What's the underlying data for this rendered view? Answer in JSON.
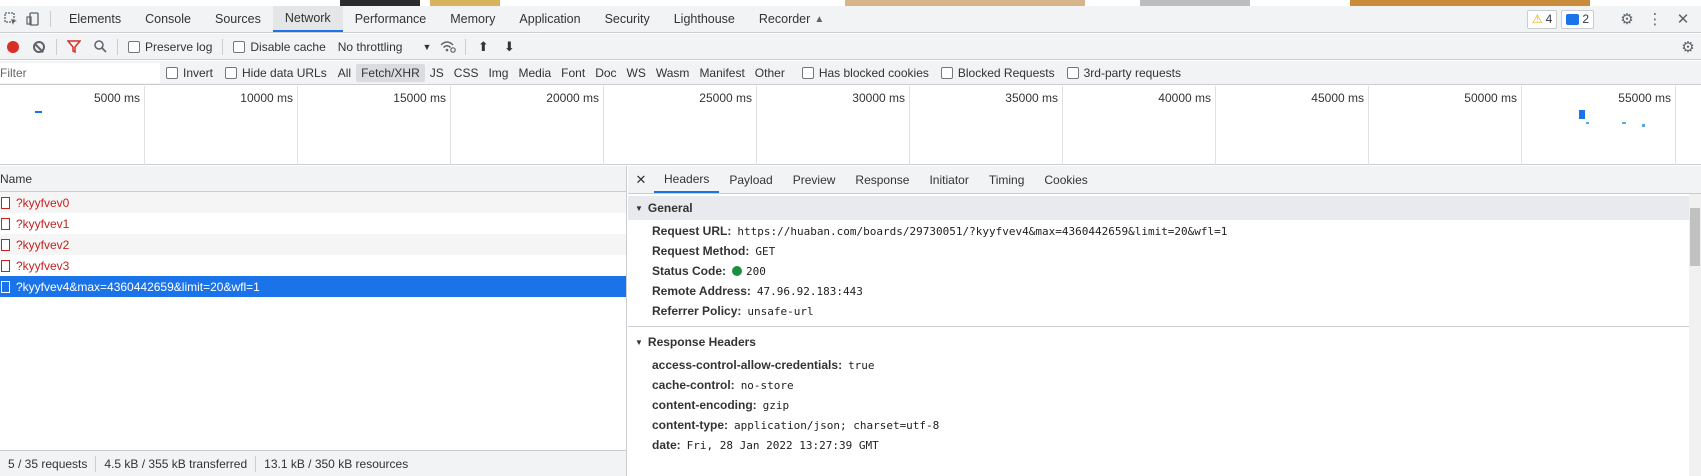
{
  "colors": {
    "accent": "#1a73e8",
    "error_text": "#c5221f",
    "record": "#d93025",
    "status_ok": "#1e8e3e",
    "toolbar_bg": "#f1f3f4"
  },
  "devtools_tabs": [
    "Elements",
    "Console",
    "Sources",
    "Network",
    "Performance",
    "Memory",
    "Application",
    "Security",
    "Lighthouse",
    "Recorder"
  ],
  "active_tab": "Network",
  "badges": {
    "warnings": "4",
    "messages": "2"
  },
  "toolbar": {
    "preserve_log": "Preserve log",
    "disable_cache": "Disable cache",
    "throttling": "No throttling"
  },
  "filter": {
    "placeholder": "Filter",
    "invert": "Invert",
    "hide_data_urls": "Hide data URLs",
    "types": [
      "All",
      "Fetch/XHR",
      "JS",
      "CSS",
      "Img",
      "Media",
      "Font",
      "Doc",
      "WS",
      "Wasm",
      "Manifest",
      "Other"
    ],
    "active_type": "Fetch/XHR",
    "has_blocked_cookies": "Has blocked cookies",
    "blocked_requests": "Blocked Requests",
    "third_party": "3rd-party requests"
  },
  "timeline_ticks": [
    "5000 ms",
    "10000 ms",
    "15000 ms",
    "20000 ms",
    "25000 ms",
    "30000 ms",
    "35000 ms",
    "40000 ms",
    "45000 ms",
    "50000 ms",
    "55000 ms"
  ],
  "request_list": {
    "header": "Name",
    "rows": [
      "?kyyfvev0",
      "?kyyfvev1",
      "?kyyfvev2",
      "?kyyfvev3",
      "?kyyfvev4&max=4360442659&limit=20&wfl=1"
    ],
    "selected_index": 4
  },
  "status_bar": {
    "requests": "5 / 35 requests",
    "transferred": "4.5 kB / 355 kB transferred",
    "resources": "13.1 kB / 350 kB resources"
  },
  "detail": {
    "tabs": [
      "Headers",
      "Payload",
      "Preview",
      "Response",
      "Initiator",
      "Timing",
      "Cookies"
    ],
    "active_tab": "Headers",
    "general": {
      "title": "General",
      "request_url_label": "Request URL:",
      "request_url": "https://huaban.com/boards/29730051/?kyyfvev4&max=4360442659&limit=20&wfl=1",
      "request_method_label": "Request Method:",
      "request_method": "GET",
      "status_code_label": "Status Code:",
      "status_code": "200",
      "remote_address_label": "Remote Address:",
      "remote_address": "47.96.92.183:443",
      "referrer_policy_label": "Referrer Policy:",
      "referrer_policy": "unsafe-url"
    },
    "response_headers": {
      "title": "Response Headers",
      "items": [
        {
          "k": "access-control-allow-credentials:",
          "v": "true"
        },
        {
          "k": "cache-control:",
          "v": "no-store"
        },
        {
          "k": "content-encoding:",
          "v": "gzip"
        },
        {
          "k": "content-type:",
          "v": "application/json; charset=utf-8"
        },
        {
          "k": "date:",
          "v": "Fri, 28 Jan 2022 13:27:39 GMT"
        }
      ]
    }
  }
}
